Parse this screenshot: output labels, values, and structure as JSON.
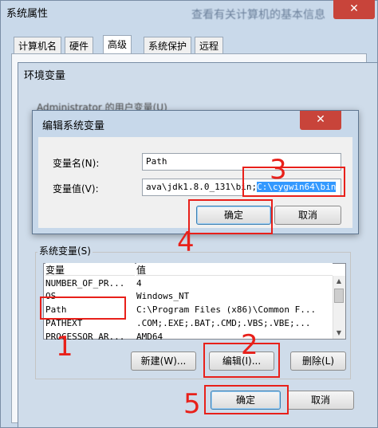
{
  "system_properties": {
    "title": "系统属性",
    "background_caption": "查看有关计算机的基本信息",
    "close_glyph": "✕",
    "tabs": [
      "计算机名",
      "硬件",
      "高级",
      "系统保护",
      "远程"
    ],
    "active_tab": "高级"
  },
  "environment_variables": {
    "title": "环境变量",
    "user_vars_group_label": "Administrator 的用户变量(U)",
    "system_vars_group_label": "系统变量(S)",
    "columns": [
      "变量",
      "值"
    ],
    "rows": [
      {
        "name": "NUMBER_OF_PR...",
        "value": "4"
      },
      {
        "name": "OS",
        "value": "Windows_NT"
      },
      {
        "name": "Path",
        "value": "C:\\Program Files (x86)\\Common F..."
      },
      {
        "name": "PATHEXT",
        "value": ".COM;.EXE;.BAT;.CMD;.VBS;.VBE;..."
      },
      {
        "name": "PROCESSOR_AR...",
        "value": "AMD64"
      }
    ],
    "buttons": {
      "new": "新建(W)...",
      "edit": "编辑(I)...",
      "delete": "删除(L)"
    },
    "ok": "确定",
    "cancel": "取消"
  },
  "edit_dialog": {
    "title": "编辑系统变量",
    "close_glyph": "✕",
    "name_label": "变量名(N):",
    "value_label": "变量值(V):",
    "name_value": "Path",
    "value_value_unselected": "ava\\jdk1.8.0_131\\bin;",
    "value_value_selected": "C:\\cygwin64\\bin",
    "ok": "确定",
    "cancel": "取消"
  },
  "annotations": {
    "step1": "1",
    "step2": "2",
    "step3": "3",
    "step4": "4",
    "step5": "5"
  },
  "colors": {
    "annotation_red": "#e8201a",
    "selection_blue": "#3399ff",
    "close_red": "#c8443a"
  }
}
